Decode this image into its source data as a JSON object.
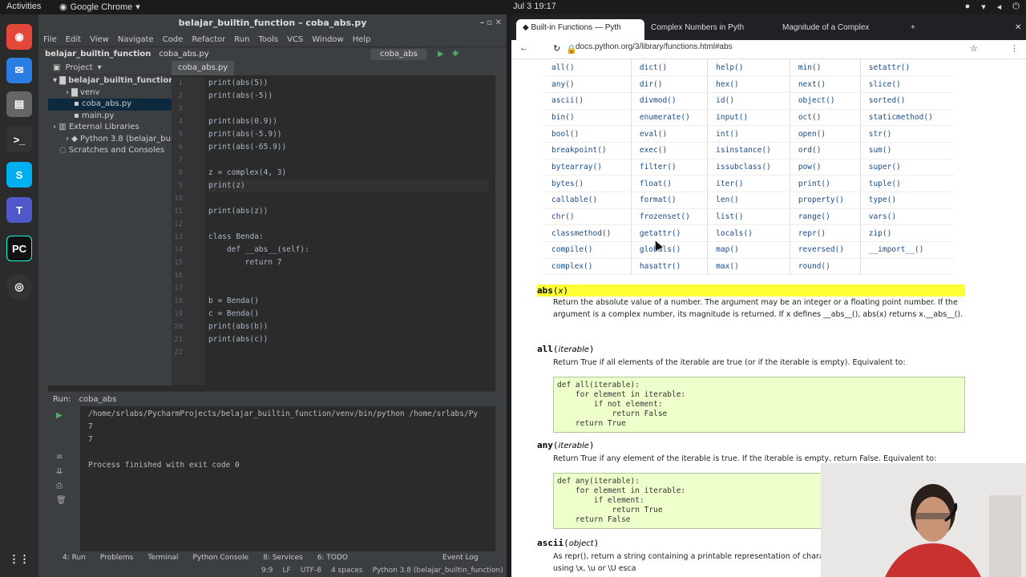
{
  "topbar": {
    "activities": "Activities",
    "app": "Google Chrome",
    "clock": "Jul 3  19:17"
  },
  "ide": {
    "title": "belajar_builtin_function – coba_abs.py",
    "menu": [
      "File",
      "Edit",
      "View",
      "Navigate",
      "Code",
      "Refactor",
      "Run",
      "Tools",
      "VCS",
      "Window",
      "Help"
    ],
    "breadcrumb_project": "belajar_builtin_function",
    "breadcrumb_file": "coba_abs.py",
    "run_config": "coba_abs",
    "project_label": "Project",
    "tree": [
      "belajar_builtin_function",
      "venv",
      "coba_abs.py",
      "main.py",
      "External Libraries",
      "Python 3.8 (belajar_bui",
      "Scratches and Consoles"
    ],
    "editor_tab": "coba_abs.py",
    "line_numbers": [
      "1",
      "2",
      "3",
      "4",
      "5",
      "6",
      "7",
      "8",
      "9",
      "10",
      "11",
      "12",
      "13",
      "14",
      "15",
      "16",
      "17",
      "18",
      "19",
      "20",
      "21",
      "22"
    ],
    "code": [
      "print(abs(5))",
      "print(abs(-5))",
      "",
      "print(abs(0.9))",
      "print(abs(-5.9))",
      "print(abs(-65.9))",
      "",
      "z = complex(4, 3)",
      "print(z)",
      "",
      "print(abs(z))",
      "",
      "class Benda:",
      "    def __abs__(self):",
      "        return 7",
      "",
      "",
      "b = Benda()",
      "c = Benda()",
      "print(abs(b))",
      "print(abs(c))",
      ""
    ],
    "run_label": "Run:",
    "run_tab": "coba_abs",
    "output": [
      "/home/srlabs/PycharmProjects/belajar_builtin_function/venv/bin/python /home/srlabs/Py",
      "7",
      "7",
      "",
      "Process finished with exit code 0"
    ],
    "bottom_tabs": [
      "4: Run",
      "Problems",
      "Terminal",
      "Python Console",
      "8: Services",
      "6: TODO",
      "Event Log"
    ],
    "status": [
      "9:9",
      "LF",
      "UTF-8",
      "4 spaces",
      "Python 3.8 (belajar_builtin_function)"
    ]
  },
  "chrome": {
    "tabs": [
      "Built-in Functions — Pyth",
      "Complex Numbers in Pyth",
      "Magnitude of a Complex"
    ],
    "url": "docs.python.org/3/library/functions.html#abs",
    "functions": [
      [
        "all()",
        "dict()",
        "help()",
        "min()",
        "setattr()"
      ],
      [
        "any()",
        "dir()",
        "hex()",
        "next()",
        "slice()"
      ],
      [
        "ascii()",
        "divmod()",
        "id()",
        "object()",
        "sorted()"
      ],
      [
        "bin()",
        "enumerate()",
        "input()",
        "oct()",
        "staticmethod()"
      ],
      [
        "bool()",
        "eval()",
        "int()",
        "open()",
        "str()"
      ],
      [
        "breakpoint()",
        "exec()",
        "isinstance()",
        "ord()",
        "sum()"
      ],
      [
        "bytearray()",
        "filter()",
        "issubclass()",
        "pow()",
        "super()"
      ],
      [
        "bytes()",
        "float()",
        "iter()",
        "print()",
        "tuple()"
      ],
      [
        "callable()",
        "format()",
        "len()",
        "property()",
        "type()"
      ],
      [
        "chr()",
        "frozenset()",
        "list()",
        "range()",
        "vars()"
      ],
      [
        "classmethod()",
        "getattr()",
        "locals()",
        "repr()",
        "zip()"
      ],
      [
        "compile()",
        "globals()",
        "map()",
        "reversed()",
        "__import__()"
      ],
      [
        "complex()",
        "hasattr()",
        "max()",
        "round()",
        ""
      ]
    ],
    "abs_sig": "abs",
    "abs_arg": "x",
    "abs_text1": "Return the absolute value of a number. The argument may be an integer or a floating point number. If the argument is a complex number, its magnitude is returned. If x defines __abs__(), abs(x) returns x.__abs__().",
    "all_sig": "all",
    "all_arg": "iterable",
    "all_text": "Return True if all elements of the iterable are true (or if the iterable is empty). Equivalent to:",
    "all_code": "def all(iterable):\n    for element in iterable:\n        if not element:\n            return False\n    return True",
    "any_sig": "any",
    "any_arg": "iterable",
    "any_text": "Return True if any element of the iterable is true. If the iterable is empty, return False. Equivalent to:",
    "any_code": "def any(iterable):\n    for element in iterable:\n        if element:\n            return True\n    return False",
    "ascii_sig": "ascii",
    "ascii_arg": "object",
    "ascii_text": "As repr(), return a string containing a printable representation of characters in the string returned by repr() using \\x, \\u or \\U esca"
  }
}
